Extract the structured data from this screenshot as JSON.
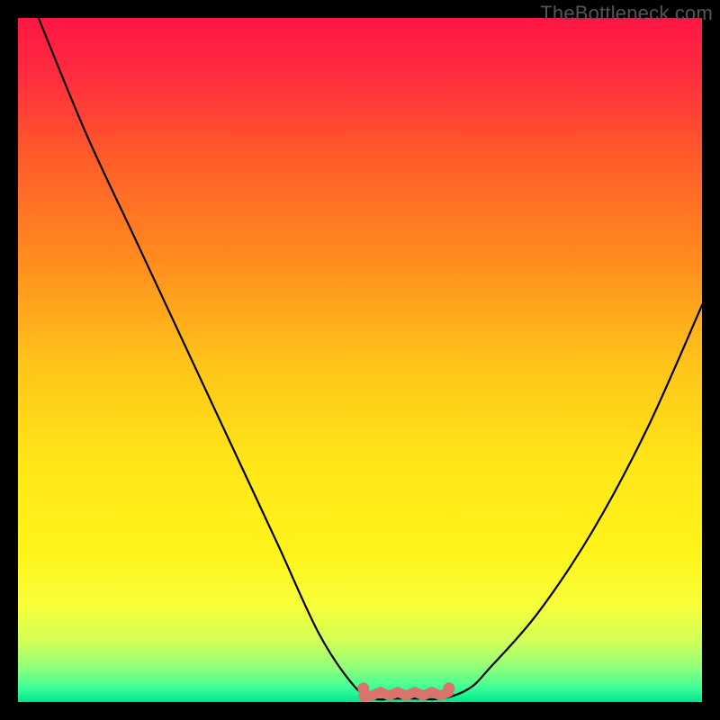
{
  "watermark": "TheBottleneck.com",
  "gradient": {
    "stops": [
      {
        "offset": 0.0,
        "color": "#ff1744"
      },
      {
        "offset": 0.08,
        "color": "#ff2b3f"
      },
      {
        "offset": 0.2,
        "color": "#ff5a2a"
      },
      {
        "offset": 0.35,
        "color": "#ff8b1e"
      },
      {
        "offset": 0.5,
        "color": "#ffc21a"
      },
      {
        "offset": 0.65,
        "color": "#ffe617"
      },
      {
        "offset": 0.78,
        "color": "#fff41a"
      },
      {
        "offset": 0.86,
        "color": "#f7ff3a"
      },
      {
        "offset": 0.91,
        "color": "#d3ff57"
      },
      {
        "offset": 0.95,
        "color": "#8fff7a"
      },
      {
        "offset": 0.98,
        "color": "#3bff9a"
      },
      {
        "offset": 1.0,
        "color": "#00e68c"
      }
    ]
  },
  "chart_data": {
    "type": "line",
    "title": "",
    "xlabel": "",
    "ylabel": "",
    "x": [
      0.03,
      0.1,
      0.17,
      0.24,
      0.31,
      0.38,
      0.44,
      0.49,
      0.52,
      0.55,
      0.58,
      0.62,
      0.66,
      0.69,
      0.76,
      0.84,
      0.92,
      1.0,
      1.0
    ],
    "y": [
      1.0,
      0.83,
      0.68,
      0.53,
      0.38,
      0.23,
      0.1,
      0.025,
      0.005,
      0.005,
      0.005,
      0.005,
      0.02,
      0.05,
      0.13,
      0.25,
      0.4,
      0.58,
      0.58
    ],
    "xlim": [
      0,
      1
    ],
    "ylim": [
      0,
      1
    ],
    "series_notes": "single V-shaped bottleneck curve, minimum plateau ≈ x 0.52–0.63",
    "flat_segment": {
      "x": [
        0.505,
        0.63
      ],
      "y": 0.012,
      "end_dots_x": [
        0.505,
        0.63
      ]
    }
  },
  "colors": {
    "curve": "#000000",
    "flat_marker": "#d8746c",
    "background": "#000000"
  }
}
